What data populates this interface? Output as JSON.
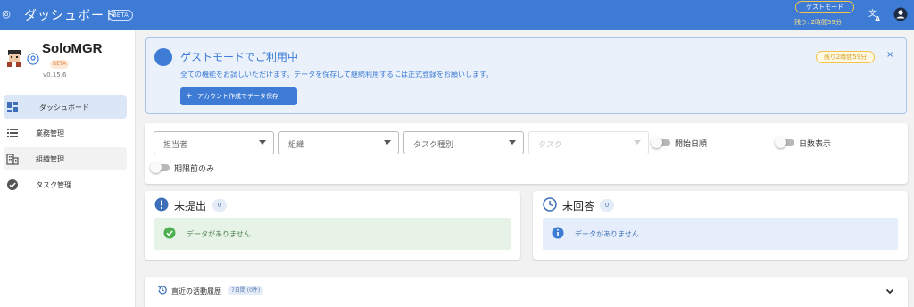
{
  "topbar": {
    "title": "ダッシュボード",
    "beta": "BETA",
    "guest_mode": "ゲストモード",
    "remaining": "残り: 2時間59分",
    "menu_icon": "app-icon",
    "translate_icon": "translate-icon",
    "account_icon": "account-circle-icon",
    "color": "#3d7bd4"
  },
  "sidebar": {
    "brand": "SoloMGR",
    "beta": "BETA",
    "version": "v0.15.6",
    "items": [
      {
        "label": "ダッシュボード",
        "icon": "dashboard-icon",
        "active": true
      },
      {
        "label": "業務管理",
        "icon": "list-icon"
      },
      {
        "label": "組織管理",
        "icon": "building-icon"
      },
      {
        "label": "タスク管理",
        "icon": "check-circle-icon"
      }
    ]
  },
  "banner": {
    "title": "ゲストモードでご利用中",
    "message": "全ての機能をお試しいただけます。データを保存して継続利用するには正式登録をお願いします。",
    "save_button": "アカウント作成でデータ保存",
    "remaining": "残り2時間59分",
    "close": "×"
  },
  "filters": {
    "assignee": "担当者",
    "organization": "組織",
    "task_type": "タスク種別",
    "task": "タスク",
    "sort_start_date": "開始日順",
    "show_days": "日数表示",
    "before_deadline_only": "期限前のみ"
  },
  "cards": {
    "unsubmitted": {
      "title": "未提出",
      "count": "0",
      "empty": "データがありません",
      "accent": "#4caf50"
    },
    "unanswered": {
      "title": "未回答",
      "count": "0",
      "empty": "データがありません",
      "accent": "#3d7bd4"
    }
  },
  "activity": {
    "title": "直近の活動履歴",
    "chip": "7日間 (0件)"
  }
}
